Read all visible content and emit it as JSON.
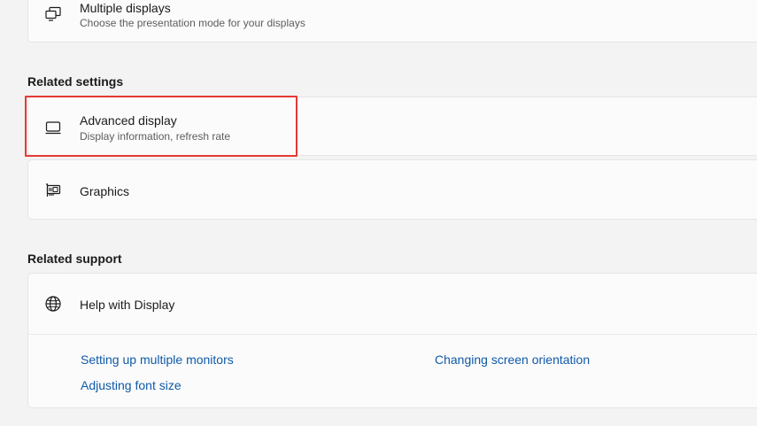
{
  "multiple_displays": {
    "title": "Multiple displays",
    "subtitle": "Choose the presentation mode for your displays",
    "icon": "multiple-displays-icon"
  },
  "related_settings": {
    "header": "Related settings",
    "advanced_display": {
      "title": "Advanced display",
      "subtitle": "Display information, refresh rate",
      "icon": "monitor-icon"
    },
    "graphics": {
      "title": "Graphics",
      "icon": "graphics-card-icon"
    }
  },
  "related_support": {
    "header": "Related support",
    "help": {
      "title": "Help with Display",
      "icon": "globe-icon"
    },
    "links": [
      "Setting up multiple monitors",
      "Changing screen orientation",
      "Adjusting font size"
    ]
  },
  "colors": {
    "background": "#f3f3f3",
    "card": "#fbfbfb",
    "link": "#0f5aa8",
    "highlight": "#e53935"
  }
}
